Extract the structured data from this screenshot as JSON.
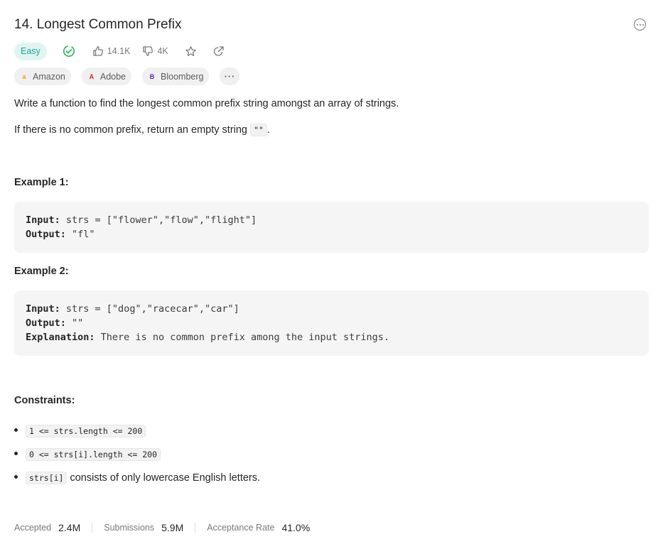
{
  "problem": {
    "title": "14. Longest Common Prefix",
    "difficulty": "Easy",
    "likes": "14.1K",
    "dislikes": "4K"
  },
  "companies": [
    {
      "name": "Amazon",
      "logo_char": "a",
      "logo_color": "#ff9900"
    },
    {
      "name": "Adobe",
      "logo_char": "A",
      "logo_color": "#e1251b"
    },
    {
      "name": "Bloomberg",
      "logo_char": "B",
      "logo_color": "#5a1fbf"
    }
  ],
  "description": {
    "line1": "Write a function to find the longest common prefix string amongst an array of strings.",
    "line2_prefix": "If there is no common prefix, return an empty string ",
    "line2_code": "\"\"",
    "line2_suffix": "."
  },
  "examples": [
    {
      "heading": "Example 1:",
      "input_label": "Input:",
      "input_value": " strs = [\"flower\",\"flow\",\"flight\"]",
      "output_label": "Output:",
      "output_value": " \"fl\""
    },
    {
      "heading": "Example 2:",
      "input_label": "Input:",
      "input_value": " strs = [\"dog\",\"racecar\",\"car\"]",
      "output_label": "Output:",
      "output_value": " \"\"",
      "explanation_label": "Explanation:",
      "explanation_value": " There is no common prefix among the input strings."
    }
  ],
  "constraints": {
    "heading": "Constraints:",
    "items": [
      {
        "code": "1 <= strs.length <= 200",
        "text": ""
      },
      {
        "code": "0 <= strs[i].length <= 200",
        "text": ""
      },
      {
        "code": "strs[i]",
        "text": "consists of only lowercase English letters."
      }
    ]
  },
  "stats": {
    "accepted_label": "Accepted",
    "accepted_value": "2.4M",
    "submissions_label": "Submissions",
    "submissions_value": "5.9M",
    "rate_label": "Acceptance Rate",
    "rate_value": "41.0%"
  },
  "colors": {
    "easy": "#1aa595",
    "solved": "#2db55d",
    "muted": "#7a7a7a"
  },
  "icons": {
    "more": "more-horizontal-circle-icon",
    "solved": "check-circle-icon",
    "like": "thumbs-up-icon",
    "dislike": "thumbs-down-icon",
    "star": "star-icon",
    "share": "share-icon"
  }
}
